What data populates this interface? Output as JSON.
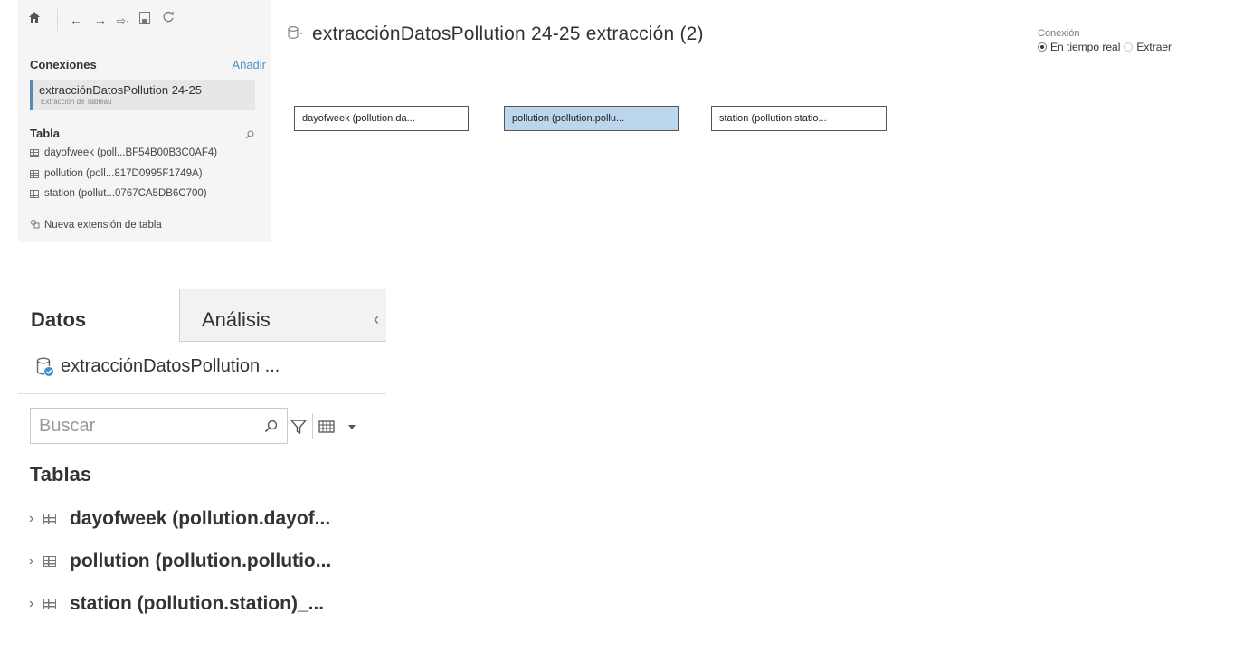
{
  "toolbar": {
    "icons": [
      "home-icon",
      "back-arrow-icon",
      "forward-arrow-icon",
      "redo-icon",
      "save-icon",
      "refresh-icon"
    ]
  },
  "connections": {
    "title": "Conexiones",
    "add_label": "Añadir",
    "items": [
      {
        "name": "extracciónDatosPollution 24-25",
        "subtitle": "Extracción de Tableau"
      }
    ]
  },
  "tables_panel": {
    "title": "Tabla",
    "items": [
      {
        "label": "dayofweek (poll...BF54B00B3C0AF4)"
      },
      {
        "label": "pollution (poll...817D0995F1749A)"
      },
      {
        "label": "station (pollut...0767CA5DB6C700)"
      }
    ],
    "new_extension_label": "Nueva extensión de tabla"
  },
  "data_source": {
    "title": "extracciónDatosPollution 24-25 extracción (2)"
  },
  "connection_type": {
    "label": "Conexión",
    "options": [
      {
        "label": "En tiempo real",
        "selected": true
      },
      {
        "label": "Extraer",
        "selected": false
      }
    ]
  },
  "canvas": {
    "nodes": [
      {
        "label": "dayofweek (pollution.da...",
        "selected": false
      },
      {
        "label": "pollution (pollution.pollu...",
        "selected": true
      },
      {
        "label": "station (pollution.statio...",
        "selected": false
      }
    ]
  },
  "data_pane": {
    "tabs": [
      {
        "label": "Datos",
        "active": true
      },
      {
        "label": "Análisis",
        "active": false
      }
    ],
    "datasource_label": "extracciónDatosPollution ...",
    "search_placeholder": "Buscar",
    "tables_heading": "Tablas",
    "tables": [
      {
        "label": "dayofweek (pollution.dayof..."
      },
      {
        "label": "pollution (pollution.pollutio..."
      },
      {
        "label": "station (pollution.station)_..."
      }
    ]
  },
  "colors": {
    "accent": "#4a91c5",
    "selected_node": "#bcd6ee",
    "panel_bg": "#f5f5f5",
    "connection_bar": "#5b89b3",
    "datasource_badge": "#3a8fd6"
  }
}
